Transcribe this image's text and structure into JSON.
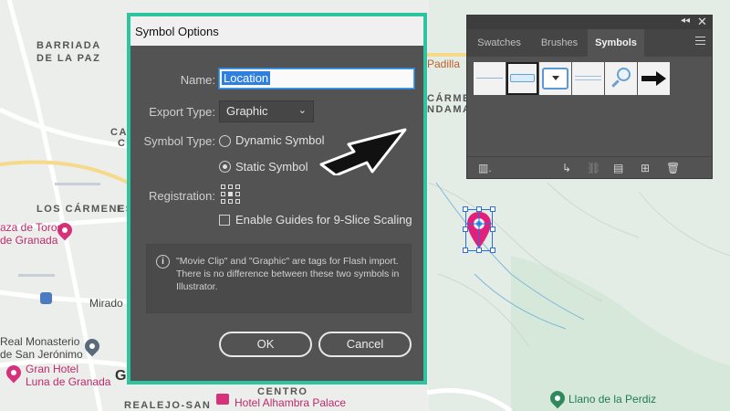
{
  "map": {
    "labels": {
      "barriada_line1": "BARRIADA",
      "barriada_line2": "DE LA PAZ",
      "los_carmenes": "LOS CÁRMENES",
      "plaza_toros_1": "aza de Toros",
      "plaza_toros_2": "de Granada",
      "mirador": "Mirado",
      "monasterio_1": "Real Monasterio",
      "monasterio_2": "de San Jerónimo",
      "gran_hotel_1": "Gran Hotel",
      "gran_hotel_2": "Luna de Granada",
      "centro": "CENTRO",
      "realejo": "REALEJO-SAN",
      "alhambra_palace": "Hotel Alhambra Palace",
      "llano_perdiz": "Llano de la Perdiz",
      "padilla": "Padilla",
      "carmen_1": "CÁRMEN",
      "carmen_2": "NDAMA",
      "ca_fragment_1": "CA",
      "ca_fragment_2": "C",
      "g_fragment": "G",
      "e_fragment": "E"
    }
  },
  "dialog": {
    "title": "Symbol Options",
    "name_label": "Name:",
    "name_value": "Location",
    "export_type_label": "Export Type:",
    "export_type_value": "Graphic",
    "symbol_type_label": "Symbol Type:",
    "dynamic_symbol_label": "Dynamic Symbol",
    "static_symbol_label": "Static Symbol",
    "symbol_type_selected": "Static Symbol",
    "registration_label": "Registration:",
    "enable_guides_label": "Enable Guides for 9-Slice Scaling",
    "enable_guides_checked": false,
    "info_text": "\"Movie Clip\" and \"Graphic\" are tags for Flash import. There is no difference between these two symbols in Illustrator.",
    "ok_label": "OK",
    "cancel_label": "Cancel",
    "frame_color": "#2ec4a0"
  },
  "symbols_panel": {
    "tabs": [
      "Swatches",
      "Brushes",
      "Symbols"
    ],
    "active_tab": "Symbols",
    "collapse_icon": "double-chevron-icon",
    "close_icon": "close-icon",
    "menu_icon": "hamburger-menu-icon",
    "symbols": [
      "thin-line-symbol",
      "blue-bar-symbol",
      "dropdown-button-symbol",
      "double-line-symbol",
      "magnifier-symbol",
      "black-arrow-symbol"
    ],
    "footer_icons": [
      "symbol-libraries-icon",
      "place-symbol-icon",
      "break-link-icon",
      "symbol-options-icon",
      "new-symbol-icon",
      "delete-symbol-icon"
    ]
  },
  "colors": {
    "pin": "#e0207a",
    "selection": "#2a6fdb"
  }
}
